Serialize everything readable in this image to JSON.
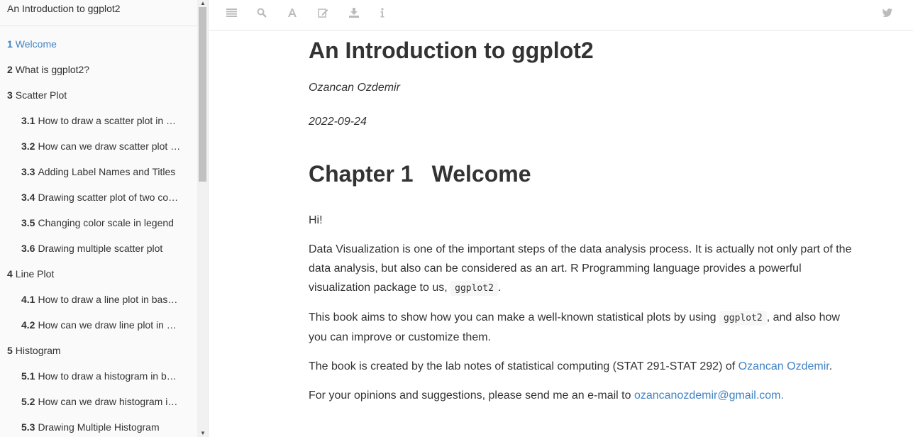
{
  "sidebar": {
    "title": "An Introduction to ggplot2",
    "items": [
      {
        "num": "1",
        "label": "Welcome",
        "active": true,
        "level": 1
      },
      {
        "num": "2",
        "label": "What is ggplot2?",
        "level": 1
      },
      {
        "num": "3",
        "label": "Scatter Plot",
        "level": 1
      },
      {
        "num": "3.1",
        "label": "How to draw a scatter plot in …",
        "level": 2
      },
      {
        "num": "3.2",
        "label": "How can we draw scatter plot …",
        "level": 2
      },
      {
        "num": "3.3",
        "label": "Adding Label Names and Titles",
        "level": 2
      },
      {
        "num": "3.4",
        "label": "Drawing scatter plot of two co…",
        "level": 2
      },
      {
        "num": "3.5",
        "label": "Changing color scale in legend",
        "level": 2
      },
      {
        "num": "3.6",
        "label": "Drawing multiple scatter plot",
        "level": 2
      },
      {
        "num": "4",
        "label": "Line Plot",
        "level": 1
      },
      {
        "num": "4.1",
        "label": "How to draw a line plot in bas…",
        "level": 2
      },
      {
        "num": "4.2",
        "label": "How can we draw line plot in …",
        "level": 2
      },
      {
        "num": "5",
        "label": "Histogram",
        "level": 1
      },
      {
        "num": "5.1",
        "label": "How to draw a histogram in b…",
        "level": 2
      },
      {
        "num": "5.2",
        "label": "How can we draw histogram i…",
        "level": 2
      },
      {
        "num": "5.3",
        "label": "Drawing Multiple Histogram",
        "level": 2
      }
    ]
  },
  "toolbar": {
    "icons": [
      "menu-icon",
      "search-icon",
      "font-icon",
      "edit-icon",
      "download-icon",
      "info-icon",
      "twitter-icon"
    ]
  },
  "main": {
    "title": "An Introduction to ggplot2",
    "author": "Ozancan Ozdemir",
    "date": "2022-09-24",
    "chapter_num": "Chapter 1",
    "chapter_title": "Welcome",
    "p_hi": "Hi!",
    "p1_text": "Data Visualization is one of the important steps of the data analysis process. It is actually not only part of the data analysis, but also can be considered as an art. R Programming language provides a powerful visualization package to us,",
    "p1_code": "ggplot2",
    "p1_end": ".",
    "p2_text": "This book aims to show how you can make a well-known statistical plots by using",
    "p2_code": "ggplot2",
    "p2_end": ", and also how you can improve or customize them.",
    "p3_text": "The book is created by the lab notes of statistical computing (STAT 291-STAT 292) of",
    "p3_link": "Ozancan Ozdemir",
    "p3_end": ".",
    "p4_text": "For your opinions and suggestions, please send me an e-mail to",
    "p4_link": "ozancanozdemir@gmail.com."
  },
  "colors": {
    "link": "#4183c4",
    "text": "#333333",
    "icon": "#bbbbbb"
  }
}
